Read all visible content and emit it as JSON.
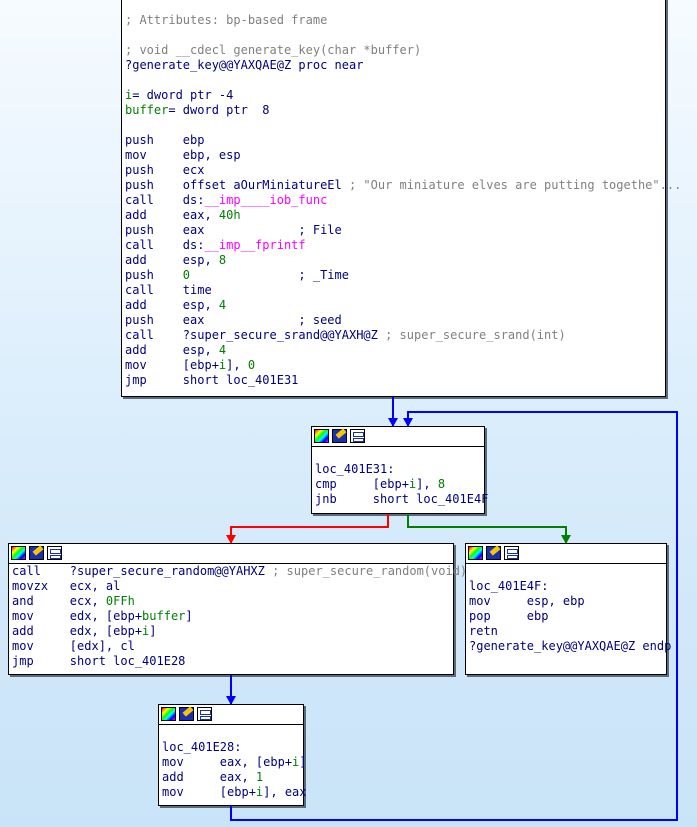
{
  "blocks": {
    "func": {
      "lines": [
        [
          [
            "; Attributes: bp-based frame",
            "cm"
          ]
        ],
        [],
        [
          [
            "; void __cdecl generate_key(char *buffer)",
            "cm"
          ]
        ],
        [
          [
            "?generate_key@@YAXQAE@Z proc near",
            "nm"
          ]
        ],
        [],
        [
          [
            "i",
            "num"
          ],
          [
            "= dword ptr -4",
            "nm"
          ]
        ],
        [
          [
            "buffer",
            "num"
          ],
          [
            "= dword ptr  8",
            "nm"
          ]
        ],
        [],
        [
          [
            "push    ebp",
            "nm"
          ]
        ],
        [
          [
            "mov     ebp, esp",
            "nm"
          ]
        ],
        [
          [
            "push    ecx",
            "nm"
          ]
        ],
        [
          [
            "push    offset aOurMiniatureEl ",
            "nm"
          ],
          [
            "; \"Our miniature elves are putting togethe\"...",
            "cm"
          ]
        ],
        [
          [
            "call    ds:",
            "nm"
          ],
          [
            "__imp____iob_func",
            "imp"
          ]
        ],
        [
          [
            "add     eax, ",
            "nm"
          ],
          [
            "40h",
            "num"
          ]
        ],
        [
          [
            "push    eax             ",
            "nm"
          ],
          [
            "; File",
            "nm"
          ]
        ],
        [
          [
            "call    ds:",
            "nm"
          ],
          [
            "__imp__fprintf",
            "imp"
          ]
        ],
        [
          [
            "add     esp, ",
            "nm"
          ],
          [
            "8",
            "num"
          ]
        ],
        [
          [
            "push    ",
            "nm"
          ],
          [
            "0",
            "num"
          ],
          [
            "               ; _Time",
            "nm"
          ]
        ],
        [
          [
            "call    time",
            "nm"
          ]
        ],
        [
          [
            "add     esp, ",
            "nm"
          ],
          [
            "4",
            "num"
          ]
        ],
        [
          [
            "push    eax             ; seed",
            "nm"
          ]
        ],
        [
          [
            "call    ?super_secure_srand@@YAXH@Z ",
            "nm"
          ],
          [
            "; super_secure_srand(int)",
            "cm"
          ]
        ],
        [
          [
            "add     esp, ",
            "nm"
          ],
          [
            "4",
            "num"
          ]
        ],
        [
          [
            "mov     [ebp+",
            "nm"
          ],
          [
            "i",
            "num"
          ],
          [
            "], ",
            "nm"
          ],
          [
            "0",
            "num"
          ]
        ],
        [
          [
            "jmp     short loc_401E31",
            "nm"
          ]
        ]
      ]
    },
    "loop_check": {
      "lines": [
        [],
        [
          [
            "loc_401E31:",
            "nm"
          ]
        ],
        [
          [
            "cmp     [ebp+",
            "nm"
          ],
          [
            "i",
            "num"
          ],
          [
            "], ",
            "nm"
          ],
          [
            "8",
            "num"
          ]
        ],
        [
          [
            "jnb     short loc_401E4F",
            "nm"
          ]
        ]
      ]
    },
    "loop_body": {
      "lines": [
        [
          [
            "call    ?super_secure_random@@YAHXZ ",
            "nm"
          ],
          [
            "; super_secure_random(void)",
            "cm"
          ]
        ],
        [
          [
            "movzx   ecx, al",
            "nm"
          ]
        ],
        [
          [
            "and     ecx, ",
            "nm"
          ],
          [
            "0FFh",
            "num"
          ]
        ],
        [
          [
            "mov     edx, [ebp+",
            "nm"
          ],
          [
            "buffer",
            "num"
          ],
          [
            "]",
            "nm"
          ]
        ],
        [
          [
            "add     edx, [ebp+",
            "nm"
          ],
          [
            "i",
            "num"
          ],
          [
            "]",
            "nm"
          ]
        ],
        [
          [
            "mov     [edx], cl",
            "nm"
          ]
        ],
        [
          [
            "jmp     short loc_401E28",
            "nm"
          ]
        ]
      ]
    },
    "exit": {
      "lines": [
        [],
        [
          [
            "loc_401E4F:",
            "nm"
          ]
        ],
        [
          [
            "mov     esp, ebp",
            "nm"
          ]
        ],
        [
          [
            "pop     ebp",
            "nm"
          ]
        ],
        [
          [
            "retn",
            "nm"
          ]
        ],
        [
          [
            "?generate_key@@YAXQAE@Z endp",
            "nm"
          ]
        ]
      ]
    },
    "increment": {
      "lines": [
        [],
        [
          [
            "loc_401E28:",
            "nm"
          ]
        ],
        [
          [
            "mov     eax, [ebp+",
            "nm"
          ],
          [
            "i",
            "num"
          ],
          [
            "]",
            "nm"
          ]
        ],
        [
          [
            "add     eax, ",
            "nm"
          ],
          [
            "1",
            "num"
          ]
        ],
        [
          [
            "mov     [ebp+",
            "nm"
          ],
          [
            "i",
            "num"
          ],
          [
            "], eax",
            "nm"
          ]
        ]
      ]
    }
  },
  "edge_colors": {
    "unconditional": "#0000ff",
    "taken": "#008000",
    "not_taken": "#ff0000"
  }
}
